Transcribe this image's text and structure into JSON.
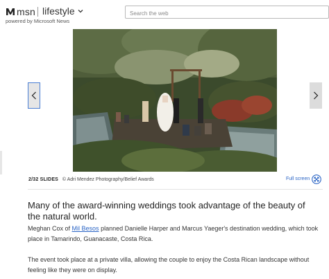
{
  "header": {
    "brand": "msn",
    "section": "lifestyle",
    "powered_by": "powered by Microsoft News",
    "search_placeholder": "Search the web"
  },
  "slideshow": {
    "slide_counter": "2/32 SLIDES",
    "credit": "© Adri Mendez Photography/Belief Awards",
    "fullscreen_label": "Full screen",
    "prev_icon": "chevron-left-icon",
    "next_icon": "chevron-right-icon"
  },
  "article": {
    "lead": "Many of the award-winning weddings took advantage of the beauty of the natural world.",
    "p1_before": "Meghan Cox of ",
    "p1_link": "Mil Besos",
    "p1_after": " planned Danielle Harper and Marcus Yaeger's destination wedding, which took place in Tamarindo, Guanacaste, Costa Rica.",
    "p2": "The event took place at a private villa, allowing the couple to enjoy the Costa Rican landscape without feeling like they were on display."
  },
  "colors": {
    "link": "#2a64c5",
    "nav_focus": "#4a7fd4"
  }
}
